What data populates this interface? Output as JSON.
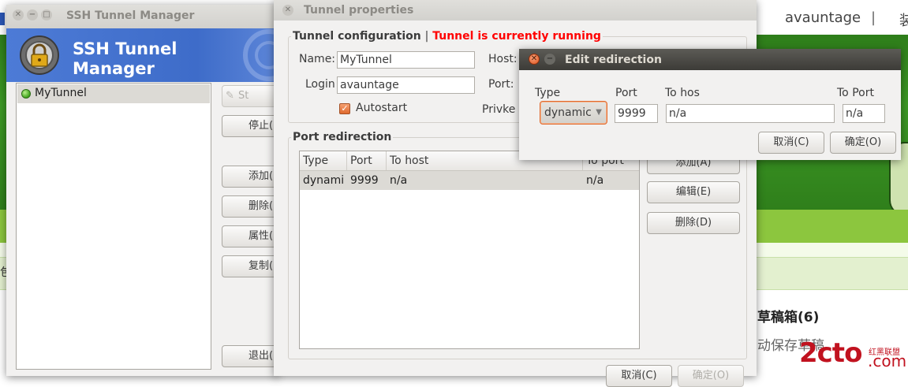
{
  "background": {
    "user": "avauntage",
    "separator": "|",
    "cjk_fragment": "装",
    "pale_bar_text": "包",
    "drafts": "草稿箱(6)",
    "autosave": "动保存草稿",
    "watermark_main": "2cto",
    "watermark_cn": "红黑联盟",
    "watermark_com": ".com"
  },
  "main_window": {
    "title": "SSH Tunnel Manager",
    "banner_title": "SSH Tunnel Manager",
    "tunnels": [
      {
        "name": "MyTunnel",
        "status_color": "#3fa31c"
      }
    ],
    "buttons": {
      "start": "St",
      "stop": "停止(",
      "add": "添加(",
      "delete": "删除(",
      "properties": "属性(",
      "copy": "复制(",
      "quit": "退出("
    }
  },
  "properties_window": {
    "title": "Tunnel properties",
    "config_title": "Tunnel configuration",
    "config_separator": "|",
    "status_text": "Tunnel is currently running",
    "status_color": "#ff0000",
    "name_label": "Name:",
    "name_value": "MyTunnel",
    "login_label": "Login",
    "login_value": "avauntage",
    "autostart_label": "Autostart",
    "autostart_checked": true,
    "host_label": "Host:",
    "port_label": "Port:",
    "privkey_label": "Privke",
    "redirection_title": "Port redirection",
    "columns": [
      "Type",
      "Port",
      "To host",
      "To port"
    ],
    "rows": [
      {
        "type": "dynami",
        "port": "9999",
        "to_host": "n/a",
        "to_port": "n/a"
      }
    ],
    "buttons": {
      "add": "添加(A)",
      "edit": "编辑(E)",
      "delete": "删除(D)",
      "cancel": "取消(C)",
      "ok": "确定(O)"
    }
  },
  "edit_window": {
    "title": "Edit redirection",
    "type_label": "Type",
    "port_label": "Port",
    "to_host_label": "To hos",
    "to_port_label": "To Port",
    "type_value": "dynamic",
    "port_value": "9999",
    "to_host_value": "n/a",
    "to_port_value": "n/a",
    "cancel": "取消(C)",
    "ok": "确定(O)"
  }
}
